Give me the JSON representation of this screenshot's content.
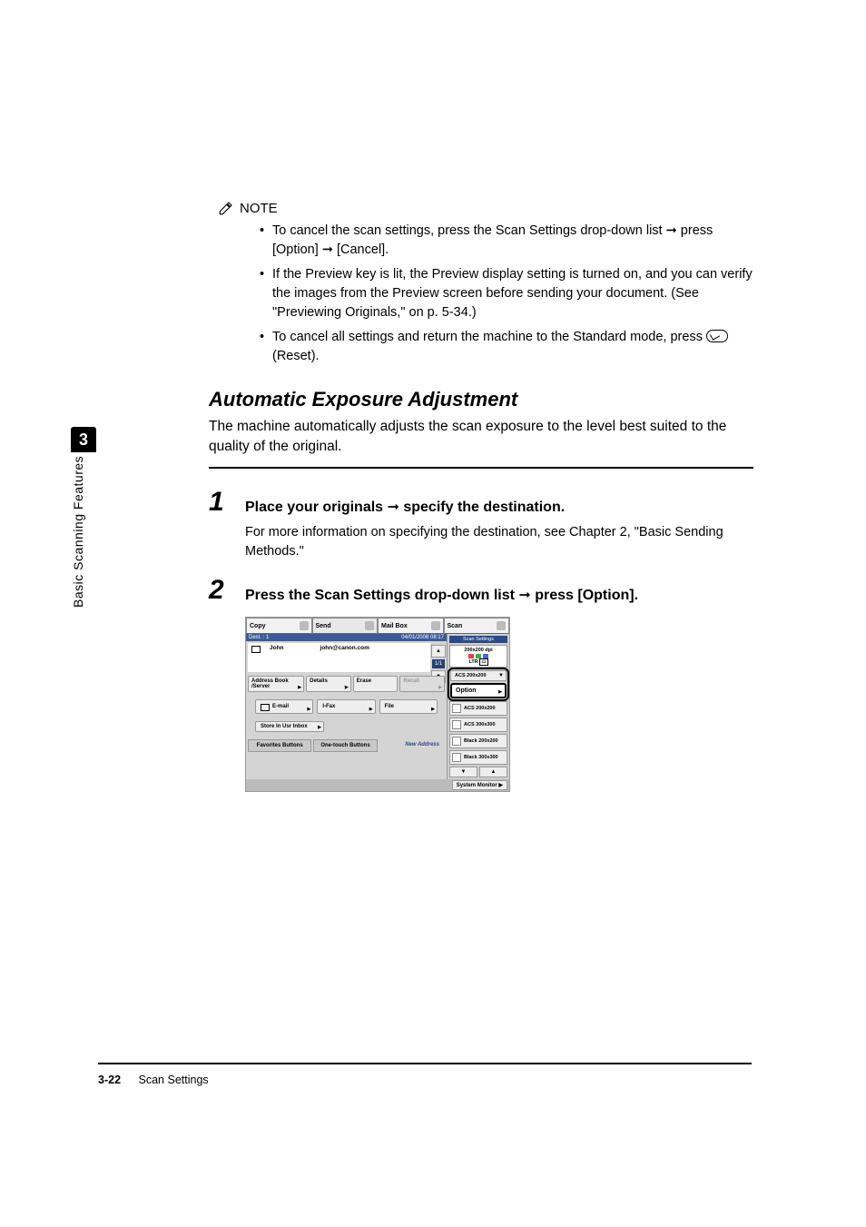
{
  "sidebar": {
    "chapter": "3",
    "label": "Basic Scanning Features"
  },
  "note": {
    "heading": "NOTE",
    "b1a": "To cancel the scan settings, press the Scan Settings drop-down list ",
    "b1b": " press [Option] ",
    "b1c": " [Cancel].",
    "b2": "If the Preview key is lit, the Preview display setting is turned on, and you can verify the images from the Preview screen before sending your document. (See \"Previewing Originals,\" on p. 5-34.)",
    "b3a": "To cancel all settings and return the machine to the Standard mode, press ",
    "b3b": " (Reset)."
  },
  "section": {
    "title": "Automatic Exposure Adjustment",
    "intro": "The machine automatically adjusts the scan exposure to the level best suited to the quality of the original."
  },
  "steps": {
    "s1num": "1",
    "s1a": "Place your originals ",
    "s1b": " specify the destination.",
    "s1sub": "For more information on specifying the destination, see Chapter 2, \"Basic Sending Methods.\"",
    "s2num": "2",
    "s2a": "Press the Scan Settings drop-down list ",
    "s2b": " press [Option]."
  },
  "arrow": "➞",
  "shot": {
    "tabs": {
      "copy": "Copy",
      "send": "Send",
      "mailbox": "Mail Box",
      "scan": "Scan"
    },
    "destbar_left": "Dest. :   1",
    "destbar_right": "04/01/2008 08:17",
    "dest_name": "John",
    "dest_addr": "john@canon.com",
    "page": "1/1",
    "row1": {
      "ab": "Address Book /Server",
      "details": "Details",
      "erase": "Erase",
      "recall": "Recall"
    },
    "mid": {
      "email": "E-mail",
      "ifax": "I-Fax",
      "file": "File"
    },
    "store": "Store In Usr Inbox",
    "bottom": {
      "fav": "Favorites Buttons",
      "ot": "One-touch Buttons",
      "na": "New Address"
    },
    "right": {
      "head": "Scan Settings",
      "res": "200x200 dpi",
      "size": "LTR",
      "sel": "ACS 200x200",
      "option": "Option",
      "i1": "ACS 200x200",
      "i2": "ACS 300x300",
      "i3": "Black 200x200",
      "i4": "Black 300x300"
    },
    "sys": "System Monitor"
  },
  "footer": {
    "page": "3-22",
    "title": "Scan Settings"
  }
}
